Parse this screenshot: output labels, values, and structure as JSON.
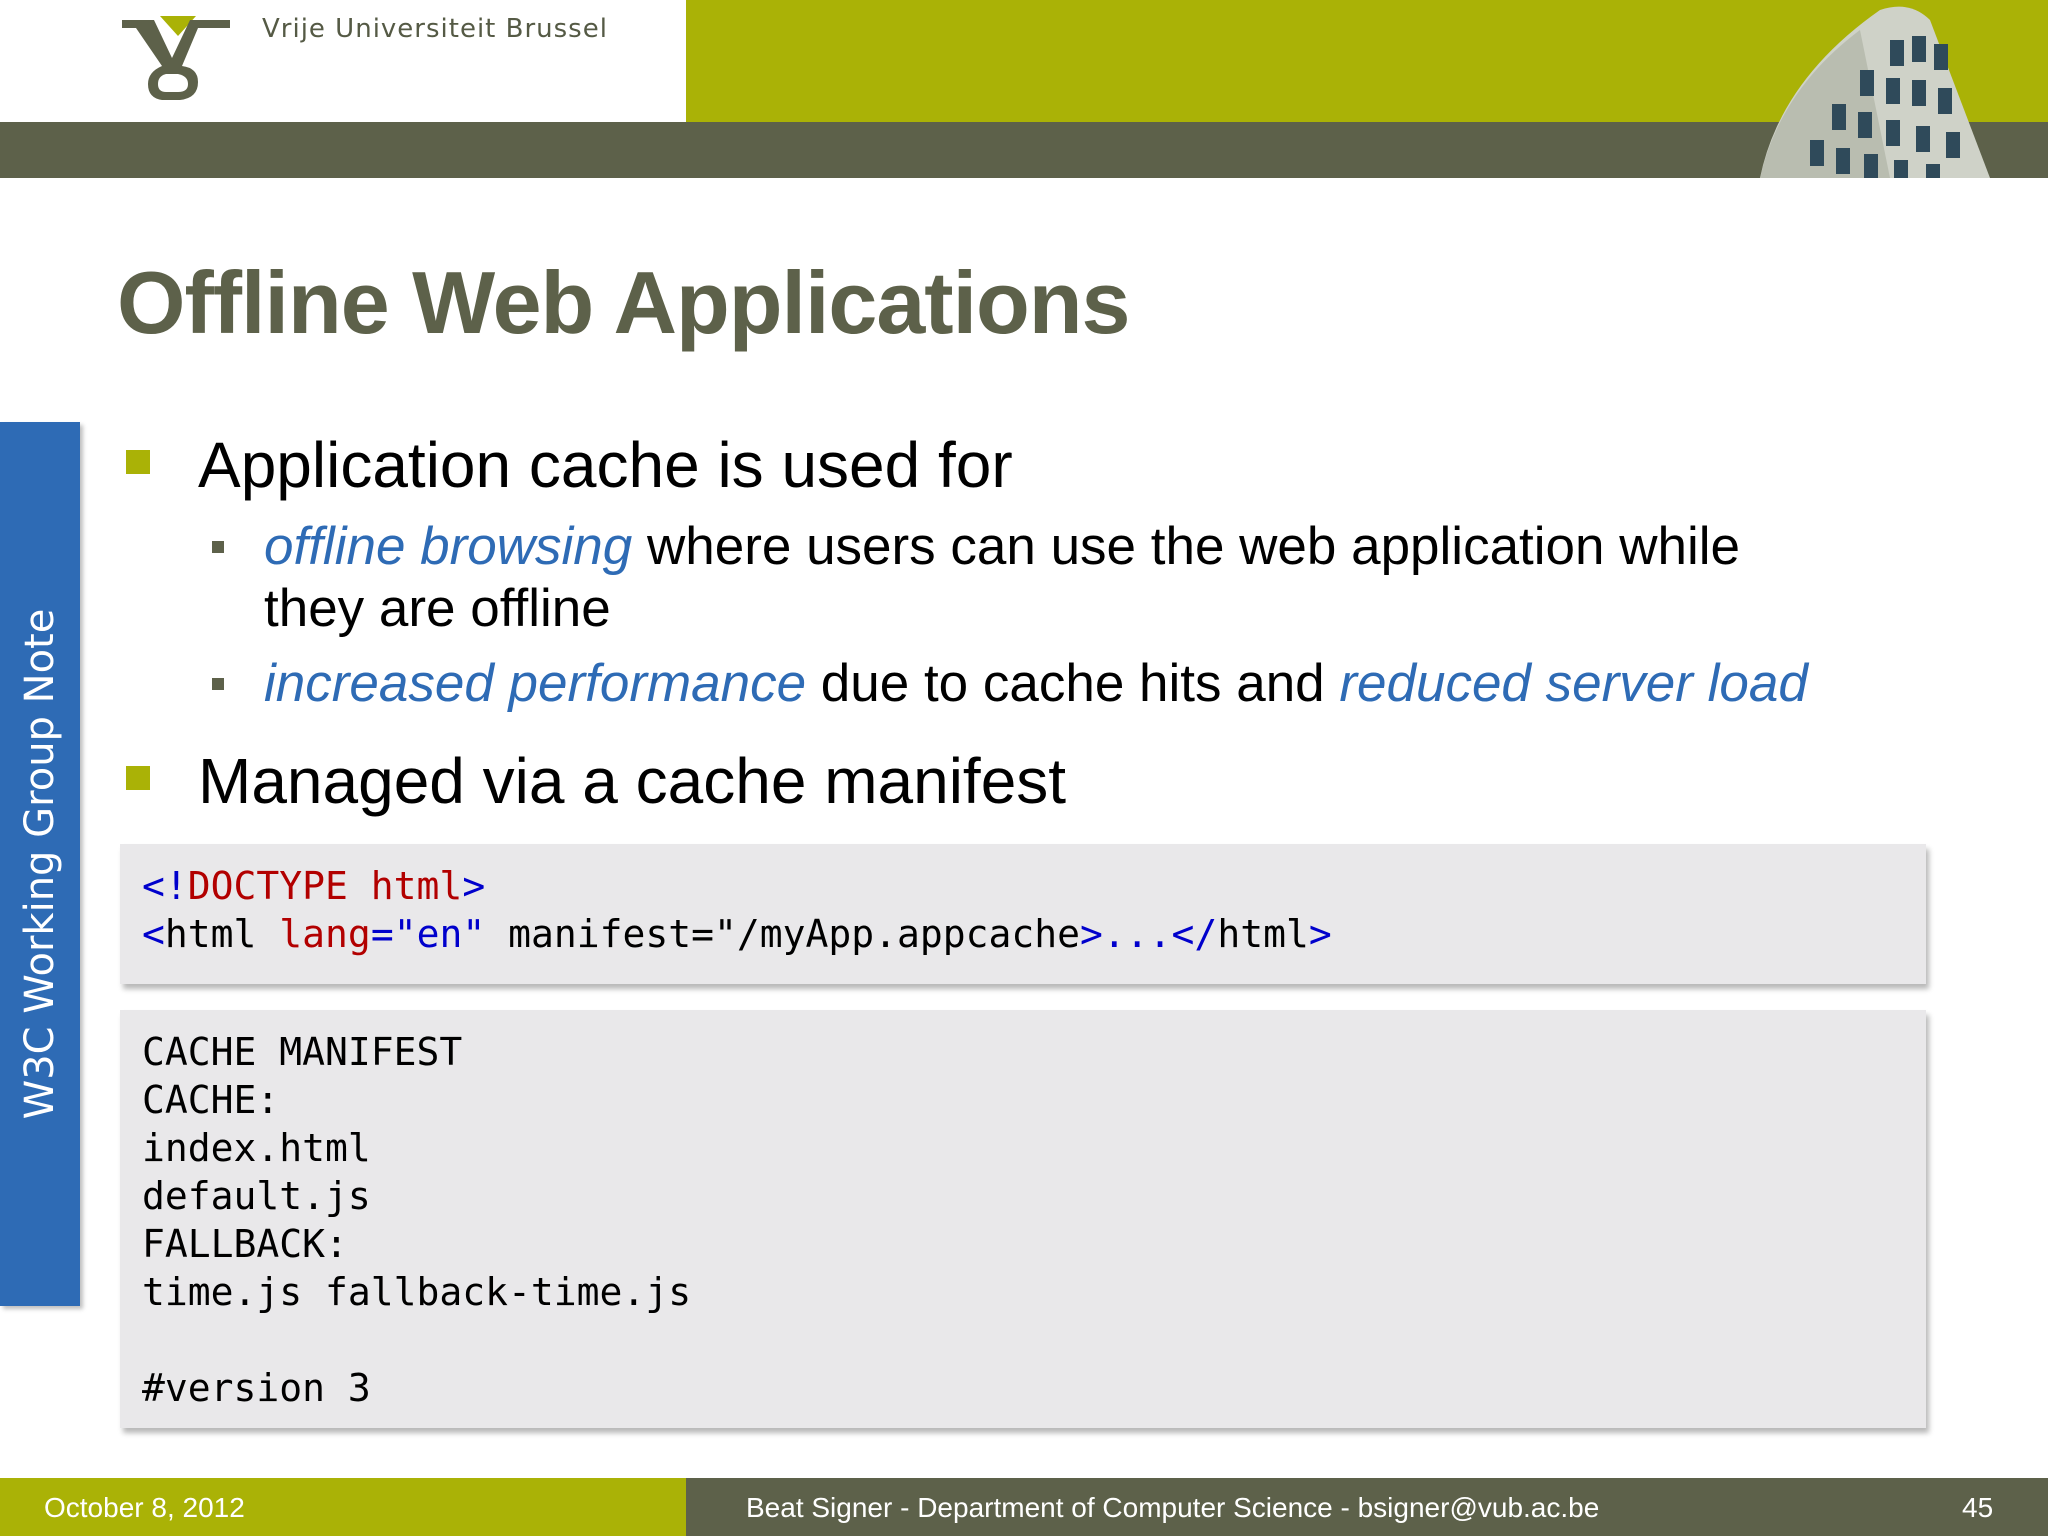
{
  "header": {
    "university_name": "Vrije Universiteit  Brussel"
  },
  "side_tab": {
    "label": "W3C Working Group Note"
  },
  "slide": {
    "title": "Offline Web Applications",
    "bullets": [
      {
        "text": "Application cache is used for",
        "sub": [
          {
            "em1": "offline browsing",
            "text1": " where users can use the web application while",
            "text2": "they are offline"
          },
          {
            "em1": "increased performance",
            "text1": " due to cache hits and ",
            "em2": "reduced server load"
          }
        ]
      },
      {
        "text": "Managed via a cache manifest"
      }
    ]
  },
  "code1": {
    "line1": {
      "a": "<!",
      "b": "DOCTYPE html",
      "c": ">"
    },
    "line2": {
      "a": "<",
      "b": "html",
      "c": " ",
      "d": "lang",
      "e": "=\"en\"",
      "f": " manifest=\"/myApp.appcache",
      "g": ">...</",
      "h": "html",
      "i": ">"
    }
  },
  "code2": {
    "lines": [
      "CACHE MANIFEST",
      "CACHE:",
      "index.html",
      "default.js",
      "FALLBACK:",
      "time.js fallback-time.js",
      "",
      "#version 3"
    ]
  },
  "footer": {
    "date": "October 8, 2012",
    "center": "Beat Signer - Department of Computer Science - bsigner@vub.ac.be",
    "page": "45"
  },
  "colors": {
    "olive": "#aab206",
    "dark_olive": "#5d614a",
    "blue": "#2e6bb5"
  }
}
